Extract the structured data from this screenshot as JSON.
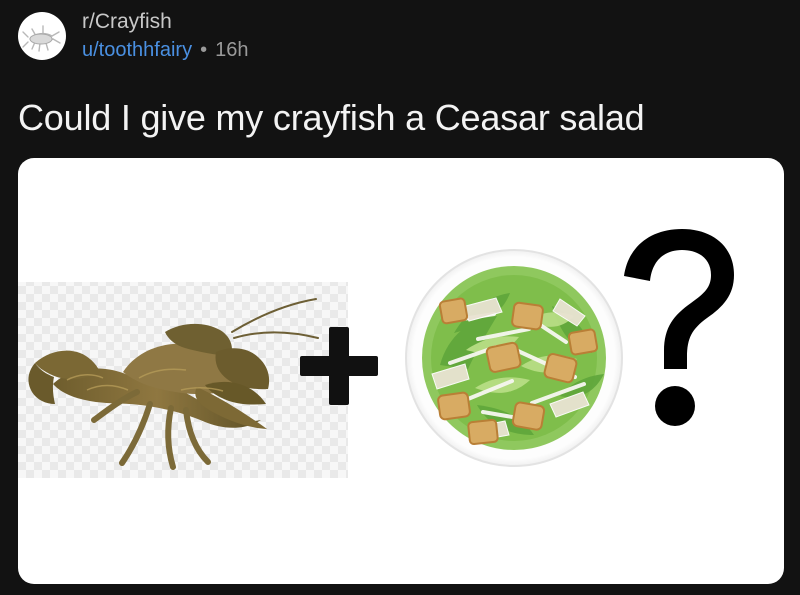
{
  "post": {
    "subreddit": "r/Crayfish",
    "username": "u/toothhfairy",
    "separator": "•",
    "age": "16h",
    "title": "Could I give my crayfish a Ceasar salad"
  },
  "image": {
    "parts": [
      "crayfish",
      "plus",
      "caesar-salad",
      "question-mark"
    ],
    "symbols": {
      "plus": "+",
      "question": "?"
    }
  },
  "colors": {
    "background": "#121212",
    "title": "#f3f3f3",
    "username": "#4a90e2",
    "muted": "#9a9a9a",
    "card": "#ffffff"
  }
}
